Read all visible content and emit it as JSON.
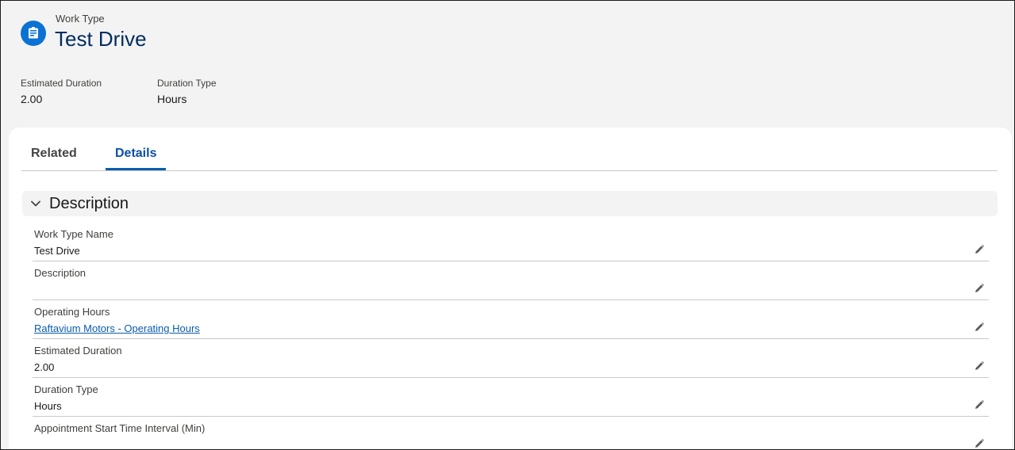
{
  "header": {
    "object_label": "Work Type",
    "title": "Test Drive",
    "icon": "work-type-icon",
    "icon_color": "#0b72d3",
    "highlights": [
      {
        "label": "Estimated Duration",
        "value": "2.00"
      },
      {
        "label": "Duration Type",
        "value": "Hours"
      }
    ]
  },
  "tabs": [
    {
      "label": "Related",
      "active": false
    },
    {
      "label": "Details",
      "active": true
    }
  ],
  "section": {
    "title": "Description",
    "expanded": true,
    "icon": "chevron-down-icon"
  },
  "fields": [
    {
      "label": "Work Type Name",
      "value": "Test Drive",
      "is_link": false
    },
    {
      "label": "Description",
      "value": "",
      "is_link": false
    },
    {
      "label": "Operating Hours",
      "value": "Raftavium Motors - Operating Hours",
      "is_link": true
    },
    {
      "label": "Estimated Duration",
      "value": "2.00",
      "is_link": false
    },
    {
      "label": "Duration Type",
      "value": "Hours",
      "is_link": false
    },
    {
      "label": "Appointment Start Time Interval (Min)",
      "value": "",
      "is_link": false
    }
  ],
  "colors": {
    "accent": "#0b5cab",
    "title": "#032d60",
    "page_bg": "#f3f3f3"
  }
}
